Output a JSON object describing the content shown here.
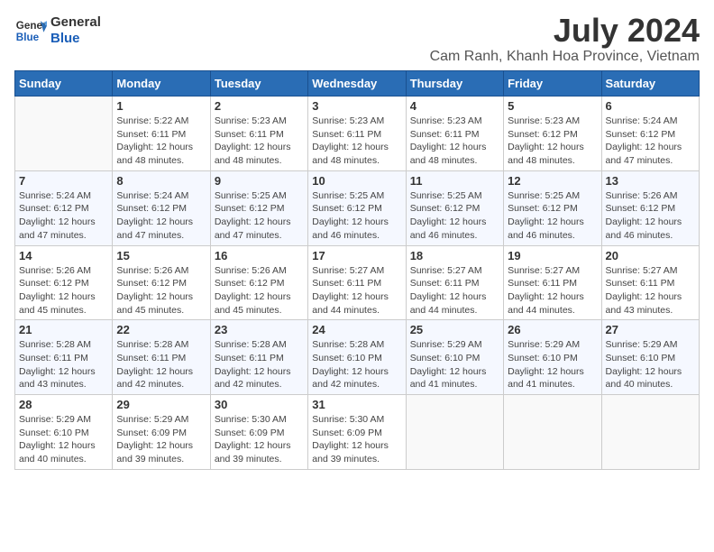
{
  "logo": {
    "line1": "General",
    "line2": "Blue"
  },
  "title": "July 2024",
  "location": "Cam Ranh, Khanh Hoa Province, Vietnam",
  "days_of_week": [
    "Sunday",
    "Monday",
    "Tuesday",
    "Wednesday",
    "Thursday",
    "Friday",
    "Saturday"
  ],
  "weeks": [
    [
      {
        "num": "",
        "info": ""
      },
      {
        "num": "1",
        "info": "Sunrise: 5:22 AM\nSunset: 6:11 PM\nDaylight: 12 hours and 48 minutes."
      },
      {
        "num": "2",
        "info": "Sunrise: 5:23 AM\nSunset: 6:11 PM\nDaylight: 12 hours and 48 minutes."
      },
      {
        "num": "3",
        "info": "Sunrise: 5:23 AM\nSunset: 6:11 PM\nDaylight: 12 hours and 48 minutes."
      },
      {
        "num": "4",
        "info": "Sunrise: 5:23 AM\nSunset: 6:11 PM\nDaylight: 12 hours and 48 minutes."
      },
      {
        "num": "5",
        "info": "Sunrise: 5:23 AM\nSunset: 6:12 PM\nDaylight: 12 hours and 48 minutes."
      },
      {
        "num": "6",
        "info": "Sunrise: 5:24 AM\nSunset: 6:12 PM\nDaylight: 12 hours and 47 minutes."
      }
    ],
    [
      {
        "num": "7",
        "info": "Sunrise: 5:24 AM\nSunset: 6:12 PM\nDaylight: 12 hours and 47 minutes."
      },
      {
        "num": "8",
        "info": "Sunrise: 5:24 AM\nSunset: 6:12 PM\nDaylight: 12 hours and 47 minutes."
      },
      {
        "num": "9",
        "info": "Sunrise: 5:25 AM\nSunset: 6:12 PM\nDaylight: 12 hours and 47 minutes."
      },
      {
        "num": "10",
        "info": "Sunrise: 5:25 AM\nSunset: 6:12 PM\nDaylight: 12 hours and 46 minutes."
      },
      {
        "num": "11",
        "info": "Sunrise: 5:25 AM\nSunset: 6:12 PM\nDaylight: 12 hours and 46 minutes."
      },
      {
        "num": "12",
        "info": "Sunrise: 5:25 AM\nSunset: 6:12 PM\nDaylight: 12 hours and 46 minutes."
      },
      {
        "num": "13",
        "info": "Sunrise: 5:26 AM\nSunset: 6:12 PM\nDaylight: 12 hours and 46 minutes."
      }
    ],
    [
      {
        "num": "14",
        "info": "Sunrise: 5:26 AM\nSunset: 6:12 PM\nDaylight: 12 hours and 45 minutes."
      },
      {
        "num": "15",
        "info": "Sunrise: 5:26 AM\nSunset: 6:12 PM\nDaylight: 12 hours and 45 minutes."
      },
      {
        "num": "16",
        "info": "Sunrise: 5:26 AM\nSunset: 6:12 PM\nDaylight: 12 hours and 45 minutes."
      },
      {
        "num": "17",
        "info": "Sunrise: 5:27 AM\nSunset: 6:11 PM\nDaylight: 12 hours and 44 minutes."
      },
      {
        "num": "18",
        "info": "Sunrise: 5:27 AM\nSunset: 6:11 PM\nDaylight: 12 hours and 44 minutes."
      },
      {
        "num": "19",
        "info": "Sunrise: 5:27 AM\nSunset: 6:11 PM\nDaylight: 12 hours and 44 minutes."
      },
      {
        "num": "20",
        "info": "Sunrise: 5:27 AM\nSunset: 6:11 PM\nDaylight: 12 hours and 43 minutes."
      }
    ],
    [
      {
        "num": "21",
        "info": "Sunrise: 5:28 AM\nSunset: 6:11 PM\nDaylight: 12 hours and 43 minutes."
      },
      {
        "num": "22",
        "info": "Sunrise: 5:28 AM\nSunset: 6:11 PM\nDaylight: 12 hours and 42 minutes."
      },
      {
        "num": "23",
        "info": "Sunrise: 5:28 AM\nSunset: 6:11 PM\nDaylight: 12 hours and 42 minutes."
      },
      {
        "num": "24",
        "info": "Sunrise: 5:28 AM\nSunset: 6:10 PM\nDaylight: 12 hours and 42 minutes."
      },
      {
        "num": "25",
        "info": "Sunrise: 5:29 AM\nSunset: 6:10 PM\nDaylight: 12 hours and 41 minutes."
      },
      {
        "num": "26",
        "info": "Sunrise: 5:29 AM\nSunset: 6:10 PM\nDaylight: 12 hours and 41 minutes."
      },
      {
        "num": "27",
        "info": "Sunrise: 5:29 AM\nSunset: 6:10 PM\nDaylight: 12 hours and 40 minutes."
      }
    ],
    [
      {
        "num": "28",
        "info": "Sunrise: 5:29 AM\nSunset: 6:10 PM\nDaylight: 12 hours and 40 minutes."
      },
      {
        "num": "29",
        "info": "Sunrise: 5:29 AM\nSunset: 6:09 PM\nDaylight: 12 hours and 39 minutes."
      },
      {
        "num": "30",
        "info": "Sunrise: 5:30 AM\nSunset: 6:09 PM\nDaylight: 12 hours and 39 minutes."
      },
      {
        "num": "31",
        "info": "Sunrise: 5:30 AM\nSunset: 6:09 PM\nDaylight: 12 hours and 39 minutes."
      },
      {
        "num": "",
        "info": ""
      },
      {
        "num": "",
        "info": ""
      },
      {
        "num": "",
        "info": ""
      }
    ]
  ]
}
